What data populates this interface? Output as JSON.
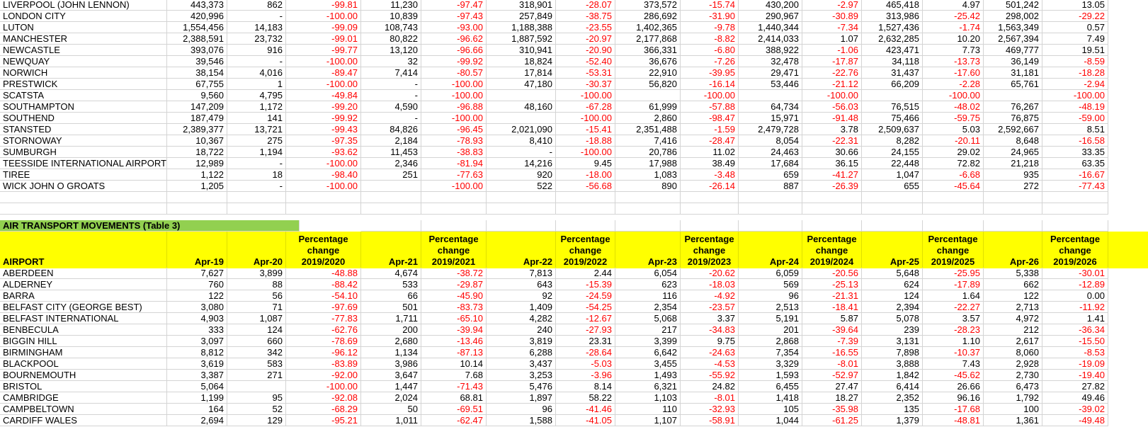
{
  "colors": {
    "negative": "#ff0000",
    "section_title_bg": "#92d050",
    "header_bg": "#ffff00",
    "gridline": "#d4d4d4"
  },
  "top_rows": [
    [
      "LIVERPOOL (JOHN LENNON)",
      "443,373",
      "862",
      "-99.81",
      "11,230",
      "-97.47",
      "318,901",
      "-28.07",
      "373,572",
      "-15.74",
      "430,200",
      "-2.97",
      "465,418",
      "4.97",
      "501,242",
      "13.05"
    ],
    [
      "LONDON CITY",
      "420,996",
      "-",
      "-100.00",
      "10,839",
      "-97.43",
      "257,849",
      "-38.75",
      "286,692",
      "-31.90",
      "290,967",
      "-30.89",
      "313,986",
      "-25.42",
      "298,002",
      "-29.22"
    ],
    [
      "LUTON",
      "1,554,456",
      "14,183",
      "-99.09",
      "108,743",
      "-93.00",
      "1,188,388",
      "-23.55",
      "1,402,365",
      "-9.78",
      "1,440,344",
      "-7.34",
      "1,527,436",
      "-1.74",
      "1,563,349",
      "0.57"
    ],
    [
      "MANCHESTER",
      "2,388,591",
      "23,732",
      "-99.01",
      "80,822",
      "-96.62",
      "1,887,592",
      "-20.97",
      "2,177,868",
      "-8.82",
      "2,414,033",
      "1.07",
      "2,632,285",
      "10.20",
      "2,567,394",
      "7.49"
    ],
    [
      "NEWCASTLE",
      "393,076",
      "916",
      "-99.77",
      "13,120",
      "-96.66",
      "310,941",
      "-20.90",
      "366,331",
      "-6.80",
      "388,922",
      "-1.06",
      "423,471",
      "7.73",
      "469,777",
      "19.51"
    ],
    [
      "NEWQUAY",
      "39,546",
      "-",
      "-100.00",
      "32",
      "-99.92",
      "18,824",
      "-52.40",
      "36,676",
      "-7.26",
      "32,478",
      "-17.87",
      "34,118",
      "-13.73",
      "36,149",
      "-8.59"
    ],
    [
      "NORWICH",
      "38,154",
      "4,016",
      "-89.47",
      "7,414",
      "-80.57",
      "17,814",
      "-53.31",
      "22,910",
      "-39.95",
      "29,471",
      "-22.76",
      "31,437",
      "-17.60",
      "31,181",
      "-18.28"
    ],
    [
      "PRESTWICK",
      "67,755",
      "1",
      "-100.00",
      "-",
      "-100.00",
      "47,180",
      "-30.37",
      "56,820",
      "-16.14",
      "53,446",
      "-21.12",
      "66,209",
      "-2.28",
      "65,761",
      "-2.94"
    ],
    [
      "SCATSTA",
      "9,560",
      "4,795",
      "-49.84",
      "-",
      "-100.00",
      "",
      "-100.00",
      "",
      "-100.00",
      "",
      "-100.00",
      "",
      "-100.00",
      "",
      "-100.00"
    ],
    [
      "SOUTHAMPTON",
      "147,209",
      "1,172",
      "-99.20",
      "4,590",
      "-96.88",
      "48,160",
      "-67.28",
      "61,999",
      "-57.88",
      "64,734",
      "-56.03",
      "76,515",
      "-48.02",
      "76,267",
      "-48.19"
    ],
    [
      "SOUTHEND",
      "187,479",
      "141",
      "-99.92",
      "-",
      "-100.00",
      "",
      "-100.00",
      "2,860",
      "-98.47",
      "15,971",
      "-91.48",
      "75,466",
      "-59.75",
      "76,875",
      "-59.00"
    ],
    [
      "STANSTED",
      "2,389,377",
      "13,721",
      "-99.43",
      "84,826",
      "-96.45",
      "2,021,090",
      "-15.41",
      "2,351,488",
      "-1.59",
      "2,479,728",
      "3.78",
      "2,509,637",
      "5.03",
      "2,592,667",
      "8.51"
    ],
    [
      "STORNOWAY",
      "10,367",
      "275",
      "-97.35",
      "2,184",
      "-78.93",
      "8,410",
      "-18.88",
      "7,416",
      "-28.47",
      "8,054",
      "-22.31",
      "8,282",
      "-20.11",
      "8,648",
      "-16.58"
    ],
    [
      "SUMBURGH",
      "18,722",
      "1,194",
      "-93.62",
      "11,453",
      "-38.83",
      "-",
      "-100.00",
      "20,786",
      "11.02",
      "24,463",
      "30.66",
      "24,155",
      "29.02",
      "24,965",
      "33.35"
    ],
    [
      "TEESSIDE INTERNATIONAL AIRPORT",
      "12,989",
      "-",
      "-100.00",
      "2,346",
      "-81.94",
      "14,216",
      "9.45",
      "17,988",
      "38.49",
      "17,684",
      "36.15",
      "22,448",
      "72.82",
      "21,218",
      "63.35"
    ],
    [
      "TIREE",
      "1,122",
      "18",
      "-98.40",
      "251",
      "-77.63",
      "920",
      "-18.00",
      "1,083",
      "-3.48",
      "659",
      "-41.27",
      "1,047",
      "-6.68",
      "935",
      "-16.67"
    ],
    [
      "WICK JOHN O GROATS",
      "1,205",
      "-",
      "-100.00",
      "",
      "-100.00",
      "522",
      "-56.68",
      "890",
      "-26.14",
      "887",
      "-26.39",
      "655",
      "-45.64",
      "272",
      "-77.43"
    ]
  ],
  "section_title": "AIR TRANSPORT MOVEMENTS (Table 3)",
  "headers": [
    "AIRPORT",
    "Apr-19",
    "Apr-20",
    "Percentage change 2019/2020",
    "Apr-21",
    "Percentage change 2019/2021",
    "Apr-22",
    "Percentage change 2019/2022",
    "Apr-23",
    "Percentage change 2019/2023",
    "Apr-24",
    "Percentage change 2019/2024",
    "Apr-25",
    "Percentage change 2019/2025",
    "Apr-26",
    "Percentage change 2019/2026"
  ],
  "bottom_rows": [
    [
      "ABERDEEN",
      "7,627",
      "3,899",
      "-48.88",
      "4,674",
      "-38.72",
      "7,813",
      "2.44",
      "6,054",
      "-20.62",
      "6,059",
      "-20.56",
      "5,648",
      "-25.95",
      "5,338",
      "-30.01"
    ],
    [
      "ALDERNEY",
      "760",
      "88",
      "-88.42",
      "533",
      "-29.87",
      "643",
      "-15.39",
      "623",
      "-18.03",
      "569",
      "-25.13",
      "624",
      "-17.89",
      "662",
      "-12.89"
    ],
    [
      "BARRA",
      "122",
      "56",
      "-54.10",
      "66",
      "-45.90",
      "92",
      "-24.59",
      "116",
      "-4.92",
      "96",
      "-21.31",
      "124",
      "1.64",
      "122",
      "0.00"
    ],
    [
      "BELFAST CITY (GEORGE BEST)",
      "3,080",
      "71",
      "-97.69",
      "501",
      "-83.73",
      "1,409",
      "-54.25",
      "2,354",
      "-23.57",
      "2,513",
      "-18.41",
      "2,394",
      "-22.27",
      "2,713",
      "-11.92"
    ],
    [
      "BELFAST INTERNATIONAL",
      "4,903",
      "1,087",
      "-77.83",
      "1,711",
      "-65.10",
      "4,282",
      "-12.67",
      "5,068",
      "3.37",
      "5,191",
      "5.87",
      "5,078",
      "3.57",
      "4,972",
      "1.41"
    ],
    [
      "BENBECULA",
      "333",
      "124",
      "-62.76",
      "200",
      "-39.94",
      "240",
      "-27.93",
      "217",
      "-34.83",
      "201",
      "-39.64",
      "239",
      "-28.23",
      "212",
      "-36.34"
    ],
    [
      "BIGGIN HILL",
      "3,097",
      "660",
      "-78.69",
      "2,680",
      "-13.46",
      "3,819",
      "23.31",
      "3,399",
      "9.75",
      "2,868",
      "-7.39",
      "3,131",
      "1.10",
      "2,617",
      "-15.50"
    ],
    [
      "BIRMINGHAM",
      "8,812",
      "342",
      "-96.12",
      "1,134",
      "-87.13",
      "6,288",
      "-28.64",
      "6,642",
      "-24.63",
      "7,354",
      "-16.55",
      "7,898",
      "-10.37",
      "8,060",
      "-8.53"
    ],
    [
      "BLACKPOOL",
      "3,619",
      "583",
      "-83.89",
      "3,986",
      "10.14",
      "3,437",
      "-5.03",
      "3,455",
      "-4.53",
      "3,329",
      "-8.01",
      "3,888",
      "7.43",
      "2,928",
      "-19.09"
    ],
    [
      "BOURNEMOUTH",
      "3,387",
      "271",
      "-92.00",
      "3,647",
      "7.68",
      "3,253",
      "-3.96",
      "1,493",
      "-55.92",
      "1,593",
      "-52.97",
      "1,842",
      "-45.62",
      "2,730",
      "-19.40"
    ],
    [
      "BRISTOL",
      "5,064",
      "",
      "-100.00",
      "1,447",
      "-71.43",
      "5,476",
      "8.14",
      "6,321",
      "24.82",
      "6,455",
      "27.47",
      "6,414",
      "26.66",
      "6,473",
      "27.82"
    ],
    [
      "CAMBRIDGE",
      "1,199",
      "95",
      "-92.08",
      "2,024",
      "68.81",
      "1,897",
      "58.22",
      "1,103",
      "-8.01",
      "1,418",
      "18.27",
      "2,352",
      "96.16",
      "1,792",
      "49.46"
    ],
    [
      "CAMPBELTOWN",
      "164",
      "52",
      "-68.29",
      "50",
      "-69.51",
      "96",
      "-41.46",
      "110",
      "-32.93",
      "105",
      "-35.98",
      "135",
      "-17.68",
      "100",
      "-39.02"
    ],
    [
      "CARDIFF WALES",
      "2,694",
      "129",
      "-95.21",
      "1,011",
      "-62.47",
      "1,588",
      "-41.05",
      "1,107",
      "-58.91",
      "1,044",
      "-61.25",
      "1,379",
      "-48.81",
      "1,361",
      "-49.48"
    ]
  ]
}
